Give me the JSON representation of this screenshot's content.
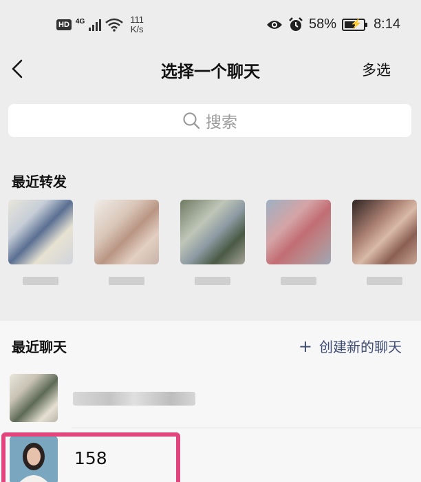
{
  "status_bar": {
    "hd": "HD",
    "network": "4G",
    "speed_value": "111",
    "speed_unit": "K/s",
    "battery": "58%",
    "battery_level": 0.58,
    "time": "8:14"
  },
  "nav": {
    "title": "选择一个聊天",
    "multi_select": "多选"
  },
  "search": {
    "placeholder": "搜索"
  },
  "recent_forwards": {
    "label": "最近转发",
    "count": 5
  },
  "recent_chats": {
    "label": "最近聊天",
    "create_new": "创建新的聊天",
    "items": [
      {
        "name": ""
      },
      {
        "name": "158"
      }
    ]
  },
  "colors": {
    "accent_link": "#3f4d73",
    "highlight": "#e0467c",
    "background": "#ededed"
  }
}
